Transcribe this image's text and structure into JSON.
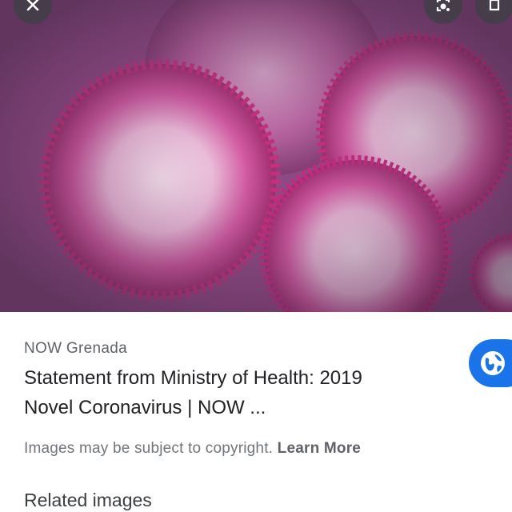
{
  "hero": {
    "image_subject": "magnified-virus-particles",
    "colors": {
      "base": "#8a3f7a",
      "particle_core": "#f6e3ef",
      "particle_rim": "#c2347f"
    }
  },
  "top_bar": {
    "close_icon": "close-icon",
    "lens_icon": "lens-icon",
    "open_icon": "open-in-new-icon"
  },
  "result": {
    "source": "NOW Grenada",
    "title_line1": "Statement from Ministry of Health: 2019",
    "title_line2": "Novel Coronavirus | NOW ...",
    "visit_icon": "globe-icon",
    "visit_color": "#1a73e8"
  },
  "copyright": {
    "text": "Images may be subject to copyright.",
    "link": "Learn More"
  },
  "related": {
    "heading": "Related images"
  }
}
